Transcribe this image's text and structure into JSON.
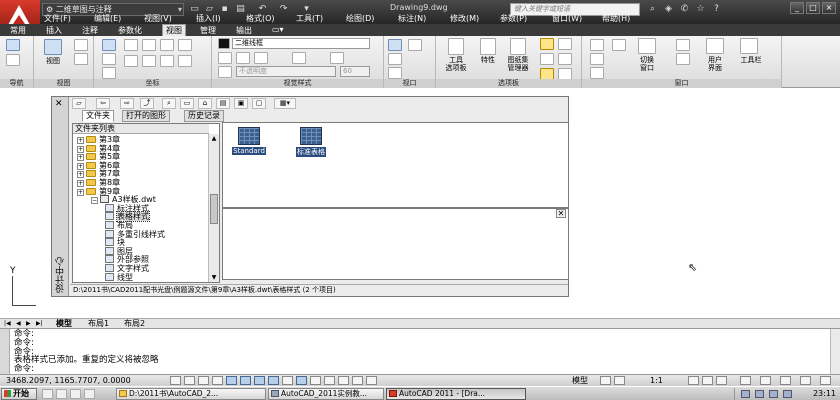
{
  "titlebar": {
    "workspace": "二维草图与注释",
    "doc_title": "Drawing9.dwg",
    "search_placeholder": "键入关键字或短语"
  },
  "menu": [
    "文件(F)",
    "编辑(E)",
    "视图(V)",
    "插入(I)",
    "格式(O)",
    "工具(T)",
    "绘图(D)",
    "标注(N)",
    "修改(M)",
    "参数(P)",
    "窗口(W)",
    "帮助(H)"
  ],
  "ribbon_tabs": [
    "常用",
    "插入",
    "注释",
    "参数化",
    "视图",
    "管理",
    "输出"
  ],
  "ribbon": {
    "panels": {
      "nav": "导航",
      "views": "视图",
      "coords": "坐标",
      "visual_styles": "视觉样式",
      "viewports": "视口",
      "palettes": "选项板",
      "window": "窗口"
    },
    "nav_button": "视图",
    "visual_style_value": "二维线框",
    "disabled_combo": "不透明度",
    "disabled_value": "60",
    "buttons": {
      "tool_palettes": "工具\n选项板",
      "properties": "特性",
      "sheet_set": "图纸集\n管理器",
      "switch_window": "切换\n窗口",
      "user_interface": "用户\n界面",
      "toolbars": "工具栏"
    }
  },
  "design_center": {
    "side_title": "设计中心",
    "tabs": [
      "文件夹",
      "打开的图形",
      "历史记录"
    ],
    "tree_header": "文件夹列表",
    "tree": [
      {
        "label": "第3章",
        "type": "folder",
        "depth": 1
      },
      {
        "label": "第4章",
        "type": "folder",
        "depth": 1
      },
      {
        "label": "第5章",
        "type": "folder",
        "depth": 1
      },
      {
        "label": "第6章",
        "type": "folder",
        "depth": 1
      },
      {
        "label": "第7章",
        "type": "folder",
        "depth": 1
      },
      {
        "label": "第8章",
        "type": "folder",
        "depth": 1
      },
      {
        "label": "第9章",
        "type": "folder",
        "depth": 1
      },
      {
        "label": "A3样板.dwt",
        "type": "dwg",
        "depth": 2
      },
      {
        "label": "标注样式",
        "type": "item",
        "depth": 3
      },
      {
        "label": "表格样式",
        "type": "item",
        "depth": 3,
        "selected": true
      },
      {
        "label": "布局",
        "type": "item",
        "depth": 3
      },
      {
        "label": "多重引线样式",
        "type": "item",
        "depth": 3
      },
      {
        "label": "块",
        "type": "item",
        "depth": 3
      },
      {
        "label": "图层",
        "type": "item",
        "depth": 3
      },
      {
        "label": "外部参照",
        "type": "item",
        "depth": 3
      },
      {
        "label": "文字样式",
        "type": "item",
        "depth": 3
      },
      {
        "label": "线型",
        "type": "item",
        "depth": 3
      }
    ],
    "items": [
      "Standard",
      "标准表格"
    ],
    "status": "D:\\2011书\\CAD2011配书光盘\\例题源文件\\第9章\\A3样板.dwt\\表格样式 (2 个项目)"
  },
  "model_tabs": [
    "模型",
    "布局1",
    "布局2"
  ],
  "command_lines": [
    "命令:",
    "命令:",
    "命令:",
    "表格样式已添加。重复的定义将被忽略",
    "命令:"
  ],
  "status": {
    "coords": "3468.2097, 1165.7707, 0.0000",
    "space": "模型",
    "scale": "1:1"
  },
  "taskbar": {
    "start": "开始",
    "tasks": [
      "D:\\2011书\\AutoCAD_2...",
      "AutoCAD_2011实例教...",
      "AutoCAD 2011 - [Dra..."
    ],
    "clock": "23:11"
  }
}
